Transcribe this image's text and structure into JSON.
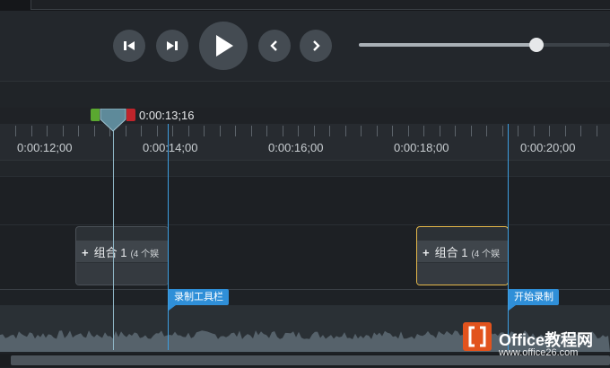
{
  "transport": {
    "buttons": [
      {
        "name": "step-back-button",
        "icon": "step-back-icon"
      },
      {
        "name": "step-forward-button",
        "icon": "step-forward-icon"
      },
      {
        "name": "play-button",
        "icon": "play-icon"
      },
      {
        "name": "previous-button",
        "icon": "chevron-left-icon"
      },
      {
        "name": "next-button",
        "icon": "chevron-right-icon"
      }
    ],
    "volume_level": 0.71
  },
  "playhead": {
    "time": "0:00:13;16",
    "colors": {
      "in": "#5aa830",
      "out": "#c0242b",
      "head": "#5e8a9a"
    }
  },
  "ruler": {
    "labels": [
      "0:00:12;00",
      "0:00:14;00",
      "0:00:16;00",
      "0:00:18;00",
      "0:00:20;00"
    ]
  },
  "tracks": {
    "groups": [
      {
        "label": "组合 1",
        "sub": "(4 个娱",
        "selected": false
      },
      {
        "label": "组合 1",
        "sub": "(4 个娱",
        "selected": true
      }
    ],
    "markers": [
      "录制工具栏",
      "开始录制"
    ]
  },
  "watermark": {
    "title": "Office教程网",
    "url": "www.office26.com",
    "accent": "#e2531d"
  },
  "colors": {
    "accent": "#2f8fd8",
    "selected": "#e5b84a"
  }
}
